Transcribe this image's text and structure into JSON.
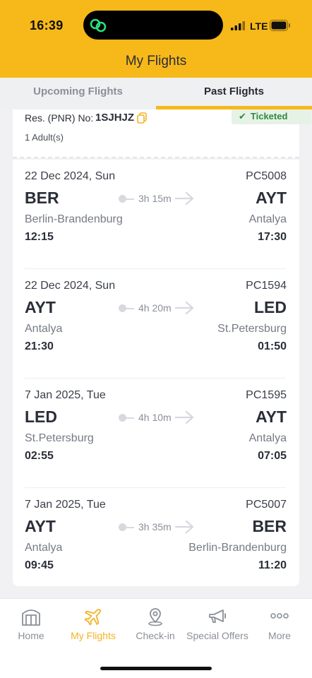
{
  "status_bar": {
    "time": "16:39",
    "network": "LTE"
  },
  "header": {
    "title": "My Flights"
  },
  "tabs": [
    {
      "label": "Upcoming Flights",
      "active": false
    },
    {
      "label": "Past Flights",
      "active": true
    }
  ],
  "reservation": {
    "pnr_label": "Res. (PNR) No:",
    "pnr": "1SJHJZ",
    "status": "Ticketed",
    "passengers": "1 Adult(s)"
  },
  "legs": [
    {
      "date": "22 Dec 2024, Sun",
      "flight_no": "PC5008",
      "from_code": "BER",
      "to_code": "AYT",
      "duration": "3h 15m",
      "from_city": "Berlin-Brandenburg",
      "to_city": "Antalya",
      "dep_time": "12:15",
      "arr_time": "17:30"
    },
    {
      "date": "22 Dec 2024, Sun",
      "flight_no": "PC1594",
      "from_code": "AYT",
      "to_code": "LED",
      "duration": "4h 20m",
      "from_city": "Antalya",
      "to_city": "St.Petersburg",
      "dep_time": "21:30",
      "arr_time": "01:50"
    },
    {
      "date": "7 Jan 2025, Tue",
      "flight_no": "PC1595",
      "from_code": "LED",
      "to_code": "AYT",
      "duration": "4h 10m",
      "from_city": "St.Petersburg",
      "to_city": "Antalya",
      "dep_time": "02:55",
      "arr_time": "07:05"
    },
    {
      "date": "7 Jan 2025, Tue",
      "flight_no": "PC5007",
      "from_code": "AYT",
      "to_code": "BER",
      "duration": "3h 35m",
      "from_city": "Antalya",
      "to_city": "Berlin-Brandenburg",
      "dep_time": "09:45",
      "arr_time": "11:20"
    }
  ],
  "tabbar": [
    {
      "label": "Home",
      "icon": "hangar-icon",
      "active": false
    },
    {
      "label": "My Flights",
      "icon": "plane-icon",
      "active": true
    },
    {
      "label": "Check-in",
      "icon": "location-pin-icon",
      "active": false
    },
    {
      "label": "Special Offers",
      "icon": "megaphone-icon",
      "active": false
    },
    {
      "label": "More",
      "icon": "more-dots-icon",
      "active": false
    }
  ],
  "colors": {
    "brand": "#f7b819",
    "ticketed": "#2e8b3e",
    "active_tab_label": "#f2b324"
  }
}
